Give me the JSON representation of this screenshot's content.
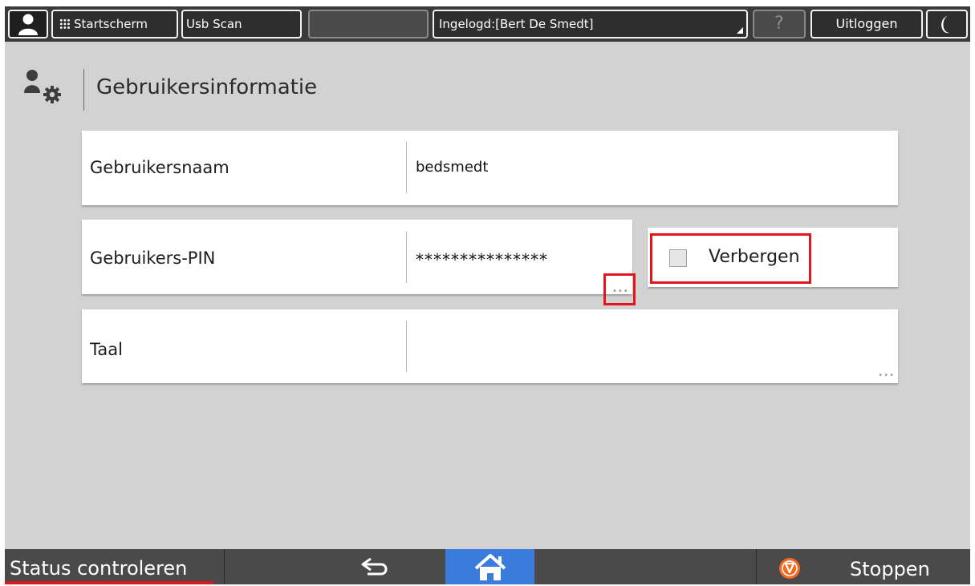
{
  "topbar": {
    "user_icon": "person-icon",
    "home_label": "Startscherm",
    "home_icon": "app-grid-icon",
    "usb_label": "Usb Scan",
    "blank_label": "",
    "login_label": "Ingelogd:[Bert De Smedt]",
    "help_label": "?",
    "logout_label": "Uitloggen",
    "energy_icon": "moon-icon"
  },
  "page": {
    "icon": "user-settings-icon",
    "title": "Gebruikersinformatie"
  },
  "fields": {
    "username": {
      "label": "Gebruikersnaam",
      "value": "bedsmedt"
    },
    "pin": {
      "label": "Gebruikers-PIN",
      "value": "***************",
      "more": "•••"
    },
    "hide": {
      "label": "Verbergen",
      "checked": false
    },
    "language": {
      "label": "Taal",
      "value": "",
      "more": "•••"
    }
  },
  "bottombar": {
    "status_label": "Status controleren",
    "back_icon": "back-arrow-icon",
    "home_icon": "home-icon",
    "stop_icon": "stop-icon",
    "stop_label": "Stoppen"
  },
  "colors": {
    "highlight": "#e3141b",
    "home_accent": "#3b7bdc",
    "stop_accent": "#f26a21"
  }
}
